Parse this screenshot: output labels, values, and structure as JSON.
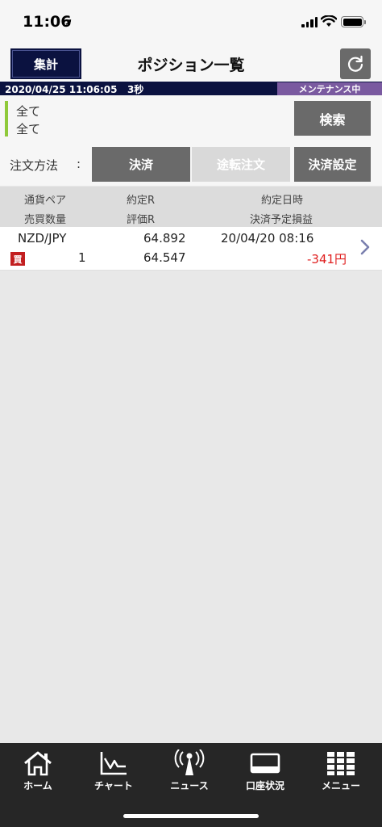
{
  "status_bar": {
    "time": "11:06"
  },
  "nav": {
    "summary_button": "集計",
    "title": "ポジション一覧"
  },
  "info_bar": {
    "datetime": "2020/04/25 11:06:05",
    "interval": "3秒",
    "maintenance": "メンテナンス中"
  },
  "filter": {
    "line1": "全て",
    "line2": "全て",
    "search_button": "検索"
  },
  "order": {
    "label": "注文方法",
    "colon": ":",
    "settle_button": "決済",
    "reverse_button": "途転注文",
    "settle_settings_button": "決済設定"
  },
  "table": {
    "headers": {
      "pair": "通貨ペア",
      "rate": "約定R",
      "datetime": "約定日時",
      "quantity": "売買数量",
      "eval_rate": "評価R",
      "pl": "決済予定損益"
    },
    "rows": [
      {
        "pair": "NZD/JPY",
        "rate": "64.892",
        "datetime": "20/04/20 08:16",
        "side": "買",
        "quantity": "1",
        "eval_rate": "64.547",
        "pl": "-341円"
      }
    ]
  },
  "tabs": [
    {
      "label": "ホーム",
      "icon": "home-icon"
    },
    {
      "label": "チャート",
      "icon": "chart-icon"
    },
    {
      "label": "ニュース",
      "icon": "news-icon"
    },
    {
      "label": "口座状況",
      "icon": "account-icon"
    },
    {
      "label": "メニュー",
      "icon": "menu-icon"
    }
  ],
  "colors": {
    "navy": "#0b1240",
    "maintenance": "#7a5aa0",
    "accent_green": "#8fc93a",
    "loss_red": "#e02020",
    "buy_red": "#c21f20",
    "tab_bar": "#262626"
  }
}
